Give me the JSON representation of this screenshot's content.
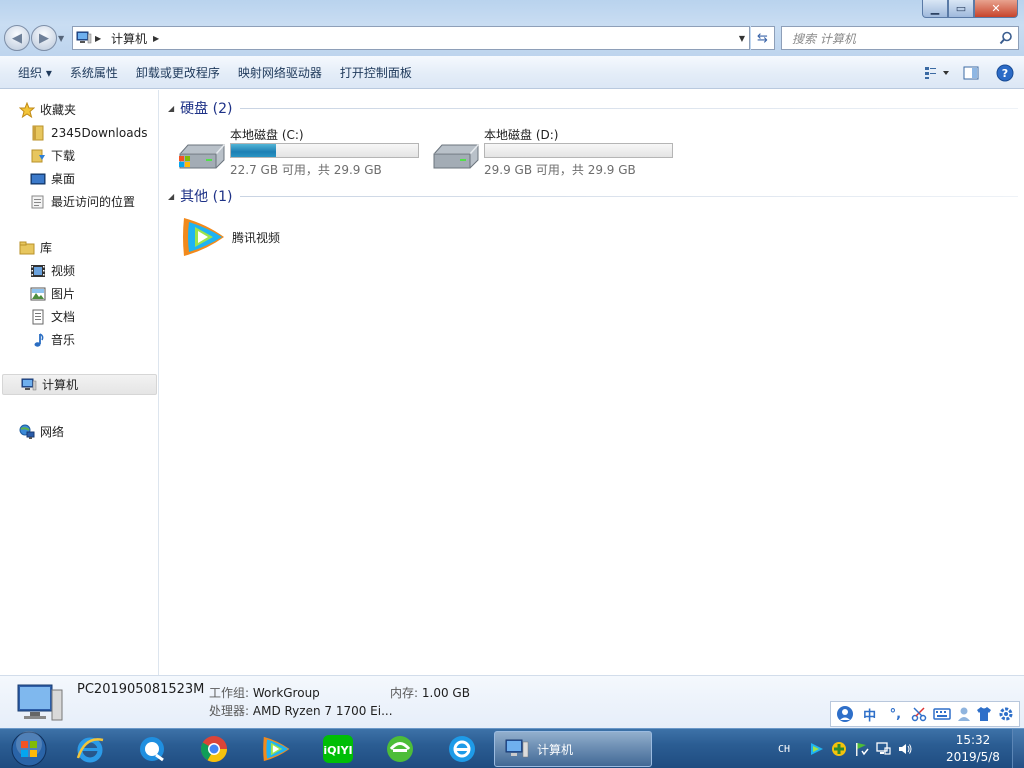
{
  "window": {
    "min_glyph": "▁",
    "max_glyph": "▭",
    "close_glyph": "✕"
  },
  "address": {
    "crumb": "计算机",
    "search_placeholder": "搜索 计算机"
  },
  "toolbar": {
    "organize": "组织 ▾",
    "system_properties": "系统属性",
    "uninstall": "卸载或更改程序",
    "map_drive": "映射网络驱动器",
    "control_panel": "打开控制面板"
  },
  "nav": {
    "favorites": "收藏夹",
    "downloads_2345": "2345Downloads",
    "downloads": "下载",
    "desktop": "桌面",
    "recent": "最近访问的位置",
    "libraries": "库",
    "videos": "视频",
    "pictures": "图片",
    "documents": "文档",
    "music": "音乐",
    "computer": "计算机",
    "network": "网络"
  },
  "groups": {
    "hard_disks": "硬盘 (2)",
    "other": "其他 (1)"
  },
  "drives": [
    {
      "name": "本地磁盘 (C:)",
      "info": "22.7 GB 可用，共 29.9 GB",
      "used_fraction": 0.24
    },
    {
      "name": "本地磁盘 (D:)",
      "info": "29.9 GB 可用，共 29.9 GB",
      "used_fraction": 0.0
    }
  ],
  "other_items": [
    {
      "name": "腾讯视频"
    }
  ],
  "details": {
    "pc_name": "PC201905081523M",
    "workgroup_label": "工作组:",
    "workgroup_value": "WorkGroup",
    "memory_label": "内存:",
    "memory_value": "1.00 GB",
    "cpu_label": "处理器:",
    "cpu_value": "AMD Ryzen 7 1700 Ei..."
  },
  "ime": {
    "chinese": "中",
    "punct": "°,"
  },
  "taskbar": {
    "active_window": "计算机",
    "lang": "CH",
    "time": "15:32",
    "date": "2019/5/8"
  },
  "colors": {
    "accent": "#1e3287",
    "drive_fill": "#1d7fb4",
    "taskbar": "#2b5d93"
  }
}
